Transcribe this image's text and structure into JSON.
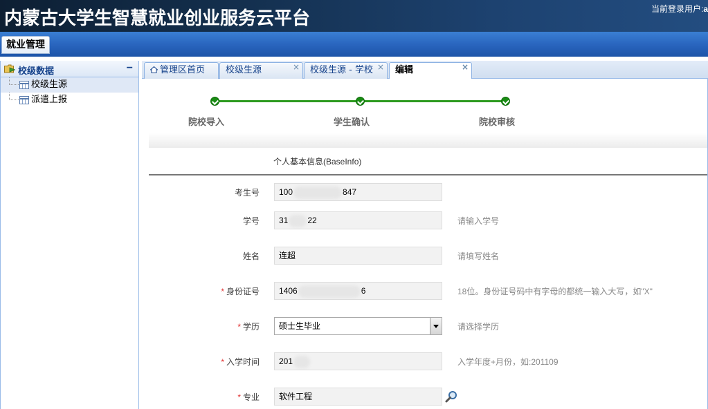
{
  "header": {
    "app_title": "内蒙古大学生智慧就业创业服务云平台",
    "user_label": "当前登录用户:",
    "user_value": "a"
  },
  "navbar": {
    "module_label": "就业管理"
  },
  "sidebar": {
    "title": "校级数据",
    "collapse": "−",
    "items": [
      {
        "label": "校级生源",
        "selected": true
      },
      {
        "label": "派遣上报",
        "selected": false
      }
    ]
  },
  "tabs": [
    {
      "label": "管理区首页",
      "closable": false,
      "active": false,
      "icon": "home-icon"
    },
    {
      "label": "校级生源",
      "closable": true,
      "active": false
    },
    {
      "label": "校级生源 - 学校",
      "closable": true,
      "active": false
    },
    {
      "label": "编辑",
      "closable": true,
      "active": true
    }
  ],
  "close_glyph": "×",
  "steps": [
    {
      "label": "院校导入",
      "done": true
    },
    {
      "label": "学生确认",
      "done": true
    },
    {
      "label": "院校审核",
      "done": true
    }
  ],
  "colors": {
    "step_green": "#2d9a1f",
    "required_star": "#e03030",
    "header_blue": "#14304f"
  },
  "section": {
    "title": "个人基本信息(BaseInfo)"
  },
  "form": {
    "fields": [
      {
        "label": "考生号",
        "required": false,
        "value_prefix": "100",
        "value_suffix": "847",
        "hint": ""
      },
      {
        "label": "学号",
        "required": false,
        "value_prefix": "31",
        "value_suffix": "22",
        "hint": "请输入学号"
      },
      {
        "label": "姓名",
        "required": false,
        "value": "连超",
        "hint": "请填写姓名"
      },
      {
        "label": "身份证号",
        "required": true,
        "value_prefix": "1406",
        "value_suffix": "6",
        "hint": "18位。身份证号码中有字母的都统一输入大写，如\"X\""
      },
      {
        "label": "学历",
        "required": true,
        "value": "硕士生毕业",
        "type": "select",
        "hint": "请选择学历"
      },
      {
        "label": "入学时间",
        "required": true,
        "value_prefix": "201",
        "value_suffix": "",
        "hint": "入学年度+月份，如:201109"
      },
      {
        "label": "专业",
        "required": true,
        "value": "软件工程",
        "hint": "",
        "icon": "magnifier-icon"
      }
    ],
    "required_mark": "*"
  }
}
